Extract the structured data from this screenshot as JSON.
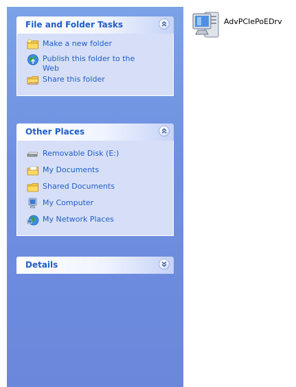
{
  "task_pane": {
    "groups": [
      {
        "title": "File and Folder Tasks",
        "state": "expanded",
        "items": [
          {
            "label": "Make a new folder",
            "icon": "new-folder-icon"
          },
          {
            "label": "Publish this folder to the Web",
            "icon": "publish-web-icon"
          },
          {
            "label": "Share this folder",
            "icon": "share-folder-icon"
          }
        ]
      },
      {
        "title": "Other Places",
        "state": "expanded",
        "items": [
          {
            "label": "Removable Disk (E:)",
            "icon": "removable-disk-icon"
          },
          {
            "label": "My Documents",
            "icon": "my-documents-icon"
          },
          {
            "label": "Shared Documents",
            "icon": "shared-documents-icon"
          },
          {
            "label": "My Computer",
            "icon": "my-computer-icon"
          },
          {
            "label": "My Network Places",
            "icon": "my-network-places-icon"
          }
        ]
      },
      {
        "title": "Details",
        "state": "collapsed",
        "items": []
      }
    ]
  },
  "files": [
    {
      "name": "AdvPCIePoEDrv",
      "icon": "setup-installer-icon"
    }
  ],
  "colors": {
    "pane_background": "#7ba2e7",
    "group_body": "#d6dff7",
    "link": "#215dc6"
  }
}
